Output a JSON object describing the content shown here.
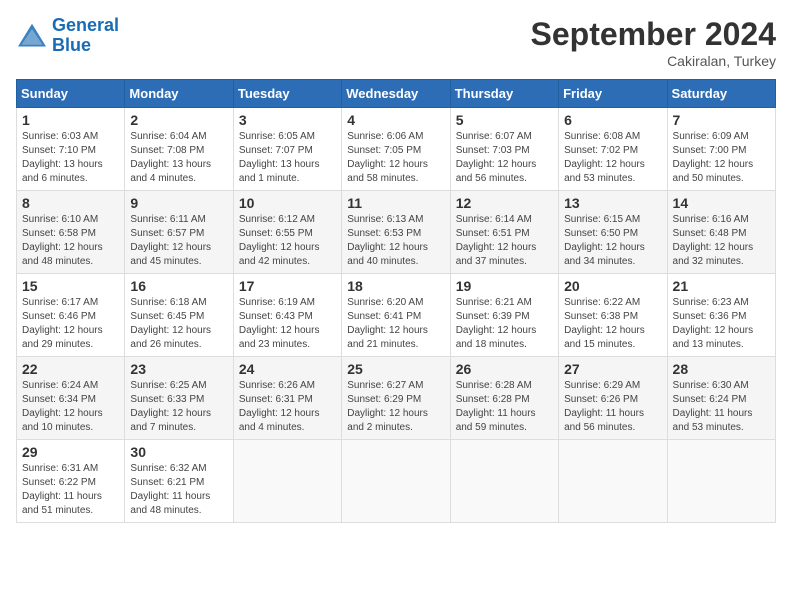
{
  "logo": {
    "line1": "General",
    "line2": "Blue"
  },
  "title": "September 2024",
  "location": "Cakiralan, Turkey",
  "headers": [
    "Sunday",
    "Monday",
    "Tuesday",
    "Wednesday",
    "Thursday",
    "Friday",
    "Saturday"
  ],
  "weeks": [
    [
      {
        "day": "1",
        "sunrise": "6:03 AM",
        "sunset": "7:10 PM",
        "daylight": "13 hours and 6 minutes."
      },
      {
        "day": "2",
        "sunrise": "6:04 AM",
        "sunset": "7:08 PM",
        "daylight": "13 hours and 4 minutes."
      },
      {
        "day": "3",
        "sunrise": "6:05 AM",
        "sunset": "7:07 PM",
        "daylight": "13 hours and 1 minute."
      },
      {
        "day": "4",
        "sunrise": "6:06 AM",
        "sunset": "7:05 PM",
        "daylight": "12 hours and 58 minutes."
      },
      {
        "day": "5",
        "sunrise": "6:07 AM",
        "sunset": "7:03 PM",
        "daylight": "12 hours and 56 minutes."
      },
      {
        "day": "6",
        "sunrise": "6:08 AM",
        "sunset": "7:02 PM",
        "daylight": "12 hours and 53 minutes."
      },
      {
        "day": "7",
        "sunrise": "6:09 AM",
        "sunset": "7:00 PM",
        "daylight": "12 hours and 50 minutes."
      }
    ],
    [
      {
        "day": "8",
        "sunrise": "6:10 AM",
        "sunset": "6:58 PM",
        "daylight": "12 hours and 48 minutes."
      },
      {
        "day": "9",
        "sunrise": "6:11 AM",
        "sunset": "6:57 PM",
        "daylight": "12 hours and 45 minutes."
      },
      {
        "day": "10",
        "sunrise": "6:12 AM",
        "sunset": "6:55 PM",
        "daylight": "12 hours and 42 minutes."
      },
      {
        "day": "11",
        "sunrise": "6:13 AM",
        "sunset": "6:53 PM",
        "daylight": "12 hours and 40 minutes."
      },
      {
        "day": "12",
        "sunrise": "6:14 AM",
        "sunset": "6:51 PM",
        "daylight": "12 hours and 37 minutes."
      },
      {
        "day": "13",
        "sunrise": "6:15 AM",
        "sunset": "6:50 PM",
        "daylight": "12 hours and 34 minutes."
      },
      {
        "day": "14",
        "sunrise": "6:16 AM",
        "sunset": "6:48 PM",
        "daylight": "12 hours and 32 minutes."
      }
    ],
    [
      {
        "day": "15",
        "sunrise": "6:17 AM",
        "sunset": "6:46 PM",
        "daylight": "12 hours and 29 minutes."
      },
      {
        "day": "16",
        "sunrise": "6:18 AM",
        "sunset": "6:45 PM",
        "daylight": "12 hours and 26 minutes."
      },
      {
        "day": "17",
        "sunrise": "6:19 AM",
        "sunset": "6:43 PM",
        "daylight": "12 hours and 23 minutes."
      },
      {
        "day": "18",
        "sunrise": "6:20 AM",
        "sunset": "6:41 PM",
        "daylight": "12 hours and 21 minutes."
      },
      {
        "day": "19",
        "sunrise": "6:21 AM",
        "sunset": "6:39 PM",
        "daylight": "12 hours and 18 minutes."
      },
      {
        "day": "20",
        "sunrise": "6:22 AM",
        "sunset": "6:38 PM",
        "daylight": "12 hours and 15 minutes."
      },
      {
        "day": "21",
        "sunrise": "6:23 AM",
        "sunset": "6:36 PM",
        "daylight": "12 hours and 13 minutes."
      }
    ],
    [
      {
        "day": "22",
        "sunrise": "6:24 AM",
        "sunset": "6:34 PM",
        "daylight": "12 hours and 10 minutes."
      },
      {
        "day": "23",
        "sunrise": "6:25 AM",
        "sunset": "6:33 PM",
        "daylight": "12 hours and 7 minutes."
      },
      {
        "day": "24",
        "sunrise": "6:26 AM",
        "sunset": "6:31 PM",
        "daylight": "12 hours and 4 minutes."
      },
      {
        "day": "25",
        "sunrise": "6:27 AM",
        "sunset": "6:29 PM",
        "daylight": "12 hours and 2 minutes."
      },
      {
        "day": "26",
        "sunrise": "6:28 AM",
        "sunset": "6:28 PM",
        "daylight": "11 hours and 59 minutes."
      },
      {
        "day": "27",
        "sunrise": "6:29 AM",
        "sunset": "6:26 PM",
        "daylight": "11 hours and 56 minutes."
      },
      {
        "day": "28",
        "sunrise": "6:30 AM",
        "sunset": "6:24 PM",
        "daylight": "11 hours and 53 minutes."
      }
    ],
    [
      {
        "day": "29",
        "sunrise": "6:31 AM",
        "sunset": "6:22 PM",
        "daylight": "11 hours and 51 minutes."
      },
      {
        "day": "30",
        "sunrise": "6:32 AM",
        "sunset": "6:21 PM",
        "daylight": "11 hours and 48 minutes."
      },
      null,
      null,
      null,
      null,
      null
    ]
  ],
  "labels": {
    "sunrise": "Sunrise:",
    "sunset": "Sunset:",
    "daylight": "Daylight:"
  }
}
